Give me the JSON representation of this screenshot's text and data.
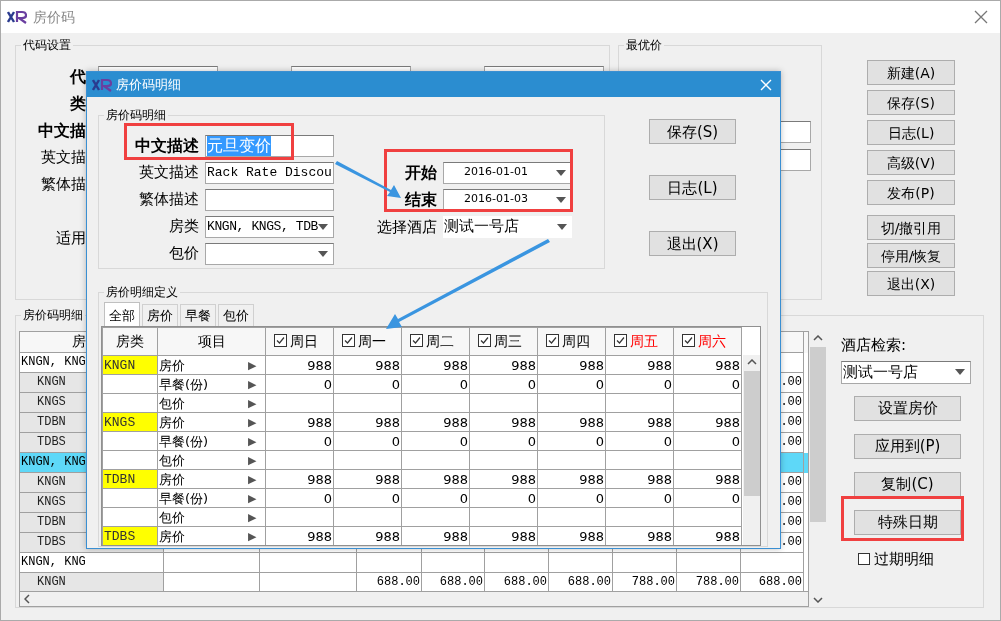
{
  "window": {
    "title": "房价码"
  },
  "code_settings": {
    "title": "代码设置",
    "labels": [
      {
        "text": "代",
        "bold": true
      },
      {
        "text": "类",
        "bold": true
      },
      {
        "text": "中文描",
        "bold": true
      },
      {
        "text": "英文描",
        "bold": false
      },
      {
        "text": "繁体描",
        "bold": false
      },
      {
        "text": "适用",
        "bold": false
      }
    ]
  },
  "best_price": {
    "title": "最优价"
  },
  "side_buttons": [
    [
      "新建(A)",
      "保存(S)",
      "日志(L)",
      "高级(V)",
      "发布(P)"
    ],
    [
      "切/撤引用",
      "停用/恢复",
      "退出(X)"
    ]
  ],
  "rate_detail": {
    "title": "房价码明细",
    "header": "房",
    "rows": [
      {
        "kind": "group",
        "code": "KNGN, KNG",
        "selected": false
      },
      {
        "kind": "detail",
        "code": "KNGN",
        "selected": false,
        "last_value": ".00"
      },
      {
        "kind": "detail",
        "code": "KNGS",
        "selected": false,
        "last_value": ".00"
      },
      {
        "kind": "detail",
        "code": "TDBN",
        "selected": false,
        "last_value": ".00"
      },
      {
        "kind": "detail",
        "code": "TDBS",
        "selected": false,
        "last_value": ".00"
      },
      {
        "kind": "group",
        "code": "KNGN, KNG",
        "selected": true
      },
      {
        "kind": "detail",
        "code": "KNGN",
        "selected": false,
        "last_value": ".00"
      },
      {
        "kind": "detail",
        "code": "KNGS",
        "selected": false,
        "last_value": ".00"
      },
      {
        "kind": "detail",
        "code": "TDBN",
        "selected": false,
        "last_value": ".00"
      },
      {
        "kind": "detail",
        "code": "TDBS",
        "selected": false,
        "last_value": ".00"
      },
      {
        "kind": "group",
        "code": "KNGN, KNG",
        "selected": false
      },
      {
        "kind": "detail",
        "code": "KNGN",
        "selected": false,
        "values": [
          "688.00",
          "688.00",
          "688.00",
          "688.00",
          "788.00",
          "788.00",
          "688.00"
        ]
      }
    ]
  },
  "hotel_search": {
    "label": "酒店检索:",
    "value": "测试一号店",
    "buttons": [
      "设置房价",
      "应用到(P)",
      "复制(C)",
      "特殊日期"
    ],
    "expired": {
      "label": "过期明细",
      "checked": false
    }
  },
  "dialog": {
    "title": "房价码明细",
    "group_title": "房价码明细",
    "fields": [
      {
        "kind": "text",
        "label": "中文描述",
        "bold": true,
        "value": "元旦变价",
        "highlighted": true
      },
      {
        "kind": "text",
        "label": "英文描述",
        "bold": false,
        "value": "Rack Rate Discou",
        "highlighted": false
      },
      {
        "kind": "text",
        "label": "繁体描述",
        "bold": false
      },
      {
        "kind": "dropdown",
        "label": "房类",
        "bold": false,
        "value": "KNGN, KNGS, TDB",
        "highlighted": false
      },
      {
        "kind": "dropdown",
        "label": "包价",
        "bold": false
      }
    ],
    "dates": [
      {
        "label": "开始",
        "value": "2016-01-01"
      },
      {
        "label": "结束",
        "value": "2016-01-03"
      }
    ],
    "hotel": {
      "label": "选择酒店",
      "value": "测试一号店"
    },
    "buttons": [
      "保存(S)",
      "日志(L)",
      "退出(X)"
    ],
    "detail_title": "房价明细定义",
    "tabs": [
      {
        "label": "全部",
        "selected": true
      },
      {
        "label": "房价",
        "selected": false
      },
      {
        "label": "早餐",
        "selected": false
      },
      {
        "label": "包价",
        "selected": false
      }
    ],
    "columns": [
      {
        "label": "房类"
      },
      {
        "label": "项目"
      },
      {
        "label": "周日",
        "checked": true
      },
      {
        "label": "周一",
        "checked": true
      },
      {
        "label": "周二",
        "checked": true
      },
      {
        "label": "周三",
        "checked": true
      },
      {
        "label": "周四",
        "checked": true
      },
      {
        "label": "周五",
        "checked": true,
        "color": "#ff0000"
      },
      {
        "label": "周六",
        "checked": true,
        "color": "#ff0000"
      }
    ],
    "rows": [
      {
        "room_type": "KNGN",
        "item": "房价",
        "arrow": "▶",
        "values": [
          "988",
          "988",
          "988",
          "988",
          "988",
          "988",
          "988"
        ]
      },
      {
        "item": "早餐(份)",
        "arrow": "▶",
        "values": [
          "0",
          "0",
          "0",
          "0",
          "0",
          "0",
          "0"
        ]
      },
      {
        "item": "包价",
        "arrow": "▶"
      },
      {
        "room_type": "KNGS",
        "item": "房价",
        "arrow": "▶",
        "values": [
          "988",
          "988",
          "988",
          "988",
          "988",
          "988",
          "988"
        ]
      },
      {
        "item": "早餐(份)",
        "arrow": "▶",
        "values": [
          "0",
          "0",
          "0",
          "0",
          "0",
          "0",
          "0"
        ]
      },
      {
        "item": "包价",
        "arrow": "▶"
      },
      {
        "room_type": "TDBN",
        "item": "房价",
        "arrow": "▶",
        "values": [
          "988",
          "988",
          "988",
          "988",
          "988",
          "988",
          "988"
        ]
      },
      {
        "item": "早餐(份)",
        "arrow": "▶",
        "values": [
          "0",
          "0",
          "0",
          "0",
          "0",
          "0",
          "0"
        ]
      },
      {
        "item": "包价",
        "arrow": "▶"
      },
      {
        "room_type": "TDBS",
        "item": "房价",
        "arrow": "▶",
        "values": [
          "988",
          "988",
          "988",
          "988",
          "988",
          "988",
          "988"
        ]
      }
    ]
  }
}
